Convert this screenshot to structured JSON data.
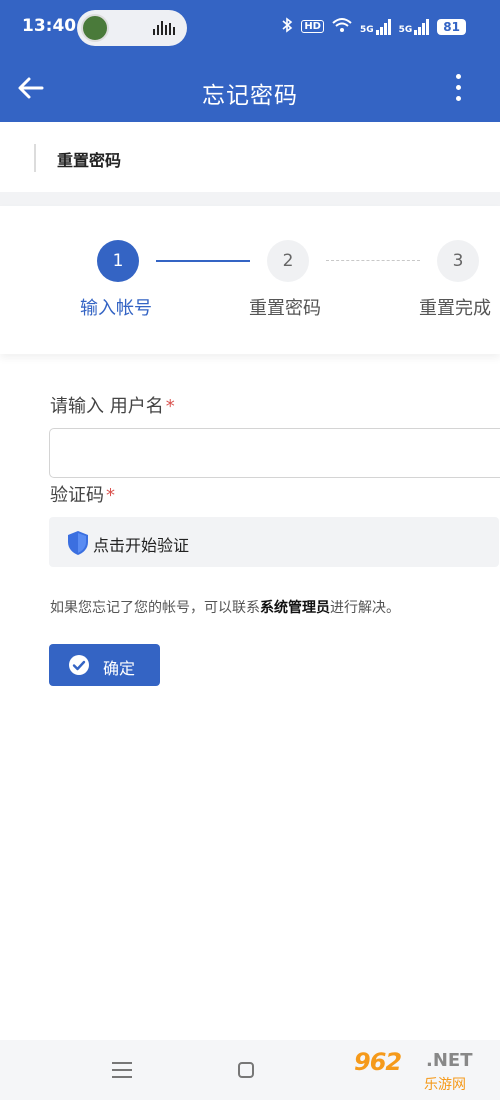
{
  "status_bar": {
    "time": "13:40",
    "hd_label": "HD",
    "signal_labels": [
      "5G",
      "5G"
    ],
    "battery": "81"
  },
  "app_bar": {
    "title": "忘记密码"
  },
  "section": {
    "title": "重置密码"
  },
  "steps": [
    {
      "number": "1",
      "label": "输入帐号",
      "active": true
    },
    {
      "number": "2",
      "label": "重置密码",
      "active": false
    },
    {
      "number": "3",
      "label": "重置完成",
      "active": false
    }
  ],
  "form": {
    "username_label": "请输入 用户名",
    "username_value": "",
    "required_mark": "*",
    "captcha_label": "验证码",
    "verify_text": "点击开始验证",
    "hint_prefix": "如果您忘记了您的帐号，可以联系",
    "hint_link": "系统管理员",
    "hint_suffix": "进行解决。",
    "confirm_label": "确定"
  },
  "watermark": {
    "number": "962",
    "suffix": ".NET",
    "site": "乐游网"
  },
  "colors": {
    "primary": "#3464c4",
    "required": "#d9534f",
    "watermark": "#f59a1b"
  }
}
